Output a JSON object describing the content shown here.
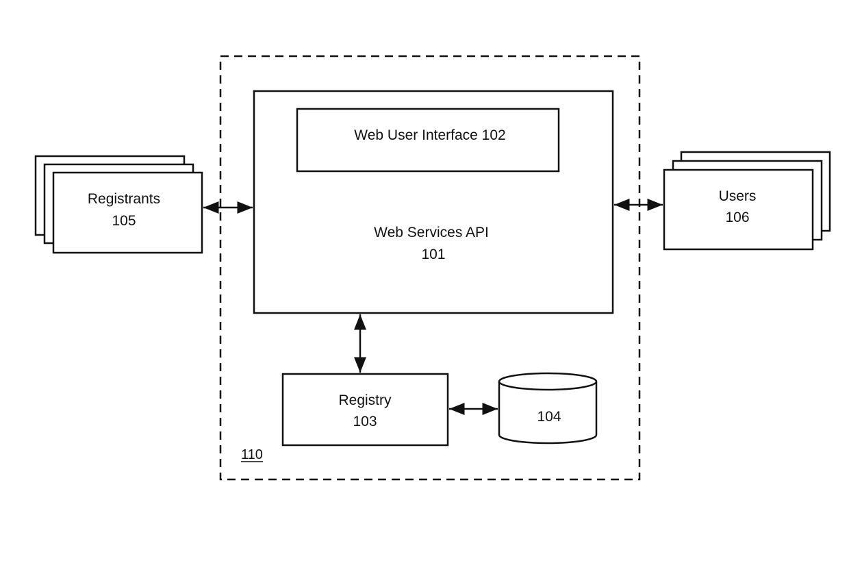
{
  "diagram": {
    "system": {
      "label": "110"
    },
    "web_services_api": {
      "title": "Web Services API",
      "number": "101"
    },
    "web_user_interface": {
      "label": "Web User Interface 102"
    },
    "registry": {
      "title": "Registry",
      "number": "103"
    },
    "database": {
      "label": "104"
    },
    "registrants": {
      "title": "Registrants",
      "number": "105"
    },
    "users": {
      "title": "Users",
      "number": "106"
    }
  },
  "connections": [
    {
      "from": "registrants",
      "to": "web_services_api",
      "type": "bidirectional"
    },
    {
      "from": "web_services_api",
      "to": "users",
      "type": "bidirectional"
    },
    {
      "from": "web_services_api",
      "to": "registry",
      "type": "bidirectional"
    },
    {
      "from": "registry",
      "to": "database",
      "type": "bidirectional"
    }
  ]
}
